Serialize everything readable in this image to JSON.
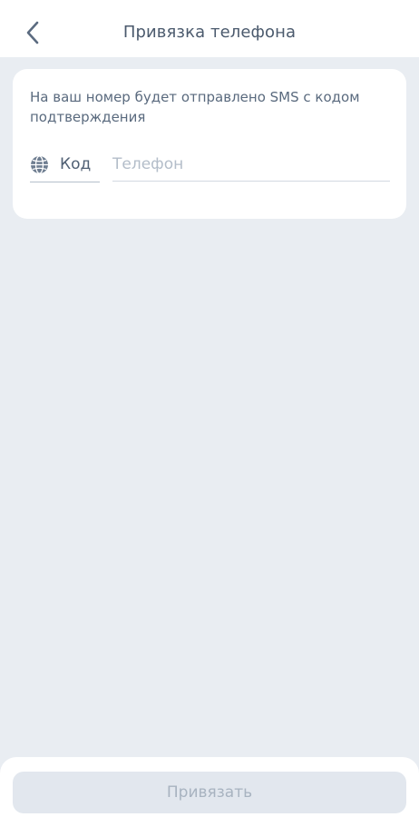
{
  "header": {
    "back_icon": "chevron-left-icon",
    "title": "Привязка телефона"
  },
  "card": {
    "info_text": "На ваш номер будет отправлено SMS с кодом подтверждения",
    "code_field": {
      "icon": "globe-icon",
      "label": "Код"
    },
    "phone_field": {
      "value": "",
      "placeholder": "Телефон"
    }
  },
  "footer": {
    "submit_label": "Привязать"
  },
  "colors": {
    "background": "#e9edf2",
    "surface": "#ffffff",
    "text_primary": "#4b5a6d",
    "placeholder": "#b3bdc9",
    "button_disabled_bg": "#e2e7ee",
    "button_disabled_text": "#a8b3c0"
  }
}
